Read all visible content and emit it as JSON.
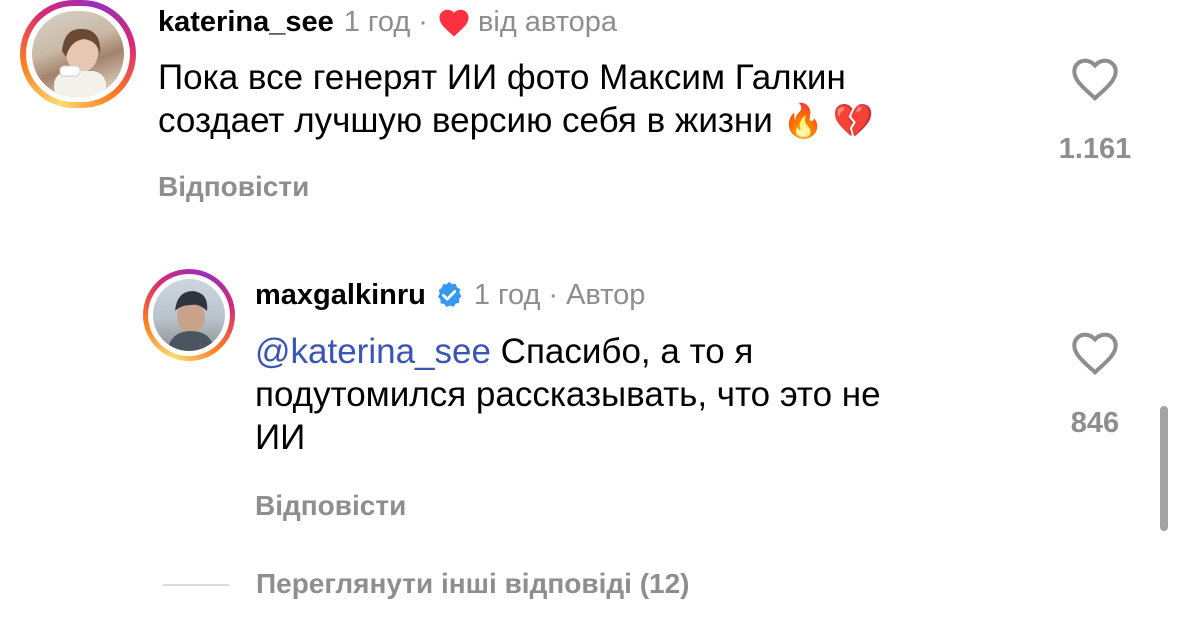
{
  "comments": [
    {
      "username": "katerina_see",
      "time": "1 год",
      "separator": "·",
      "liked_by_author": "від автора",
      "text_line1": "Пока все генерят ИИ фото Максим Галкин",
      "text_line2": "создает лучшую версию себя в жизни",
      "emoji": "🔥 💔",
      "reply_label": "Відповісти",
      "likes": "1.161"
    },
    {
      "username": "maxgalkinru",
      "time": "1 год",
      "separator": "·",
      "author_label": "Автор",
      "mention": "@katerina_see",
      "text_line1": " Спасибо, а то я",
      "text_line2": "подутомился рассказывать, что это не",
      "text_line3": "ИИ",
      "reply_label": "Відповісти",
      "likes": "846"
    }
  ],
  "more_replies": "Переглянути інші відповіді (12)",
  "colors": {
    "heart_red": "#ff3040",
    "verified_blue": "#3897f0",
    "secondary_text": "#8e8e8e",
    "mention": "#3a55b4"
  }
}
